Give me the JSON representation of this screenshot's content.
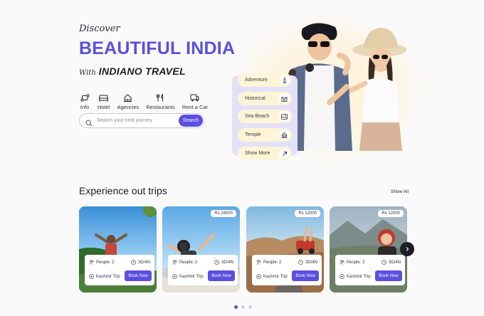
{
  "hero": {
    "discover": "Discover",
    "headline": "BEAUTIFUL INDIA",
    "with": "With",
    "brand": "INDIANO TRAVEL"
  },
  "categories": [
    {
      "label": "Info",
      "icon": "route-icon"
    },
    {
      "label": "Hotel",
      "icon": "bed-icon"
    },
    {
      "label": "Agencies",
      "icon": "building-icon"
    },
    {
      "label": "Restaurants",
      "icon": "cutlery-icon"
    },
    {
      "label": "Rent a Car",
      "icon": "car-icon"
    }
  ],
  "search": {
    "placeholder": "Search your next journey",
    "button": "Search"
  },
  "tags": [
    {
      "label": "Adventure",
      "icon": "monument-icon"
    },
    {
      "label": "Historical",
      "icon": "fort-icon"
    },
    {
      "label": "Sea Beach",
      "icon": "beach-icon"
    },
    {
      "label": "Temple",
      "icon": "temple-icon"
    },
    {
      "label": "Show More",
      "icon": "arrow-up-right-icon"
    }
  ],
  "trips": {
    "title": "Experience out trips",
    "show_all": "Show All",
    "cards": [
      {
        "price": "",
        "people": "People: 2",
        "duration": "3D/4N",
        "destination": "Kashmir Trip",
        "book": "Book Now"
      },
      {
        "price": "Rs 24000",
        "people": "People: 2",
        "duration": "3D/4N",
        "destination": "Kashmir Trip",
        "book": "Book Now"
      },
      {
        "price": "Rs 12000",
        "people": "People: 2",
        "duration": "3D/4N",
        "destination": "Kashmir Trip",
        "book": "Book Now"
      },
      {
        "price": "Rs 12000",
        "people": "People: 2",
        "duration": "3D/4N",
        "destination": "Kashmir Trip",
        "book": "Book Now"
      }
    ]
  },
  "pagination": {
    "pages": 3,
    "active": 1
  },
  "colors": {
    "accent": "#5a4fe0",
    "tag_bg": "#fff4d6",
    "panel": "#e3e1f8"
  }
}
